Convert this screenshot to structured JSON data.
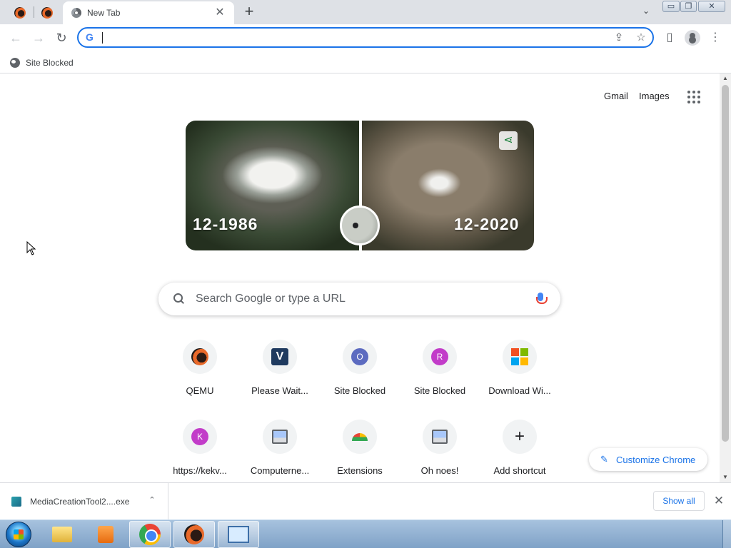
{
  "tabs": {
    "pinned": [
      {
        "icon": "qemu-icon"
      },
      {
        "icon": "qemu-icon"
      }
    ],
    "active": {
      "title": "New Tab",
      "icon": "chrome-icon",
      "close": "✕"
    },
    "new_tab": "+",
    "tab_list": "⌄"
  },
  "window": {
    "minimize": "▭",
    "restore": "❐",
    "close": "✕"
  },
  "toolbar": {
    "back": "←",
    "forward": "→",
    "reload": "↻",
    "omnibox_value": "",
    "share": "⇪",
    "bookmark": "☆",
    "side_panel": "▯",
    "menu": "⋮"
  },
  "bookmarks": [
    {
      "label": "Site Blocked",
      "icon": "globe-icon"
    }
  ],
  "ntp": {
    "gmail": "Gmail",
    "images": "Images",
    "doodle": {
      "left_date": "12-1986",
      "right_date": "12-2020"
    },
    "search_placeholder": "Search Google or type a URL",
    "shortcuts": [
      {
        "label": "QEMU",
        "icon": "qemu-icon"
      },
      {
        "label": "Please Wait...",
        "icon": "v-icon"
      },
      {
        "label": "Site Blocked",
        "icon": "letter-icon",
        "letter": "O",
        "color": "#5c6bc0"
      },
      {
        "label": "Site Blocked",
        "icon": "letter-icon",
        "letter": "R",
        "color": "#c23cc9"
      },
      {
        "label": "Download Wi...",
        "icon": "windows-icon"
      },
      {
        "label": "https://kekv...",
        "icon": "letter-icon",
        "letter": "K",
        "color": "#c23cc9"
      },
      {
        "label": "Computerne...",
        "icon": "computer-icon"
      },
      {
        "label": "Extensions",
        "icon": "chrome-icon"
      },
      {
        "label": "Oh noes!",
        "icon": "computer-icon"
      },
      {
        "label": "Add shortcut",
        "icon": "plus-icon"
      }
    ],
    "customize": "Customize Chrome"
  },
  "downloads": {
    "file": "MediaCreationTool2....exe",
    "chevron": "⌃",
    "show_all": "Show all",
    "close": "✕"
  },
  "taskbar": {
    "apps": [
      "start-orb-icon",
      "explorer-icon",
      "media-player-icon",
      "chrome-icon",
      "qemu-icon",
      "network-icon"
    ],
    "active_app": "chrome-icon"
  },
  "colors": {
    "accent": "#1a73e8",
    "tabstrip": "#dee1e6",
    "taskbar": "#8fb0d3"
  }
}
